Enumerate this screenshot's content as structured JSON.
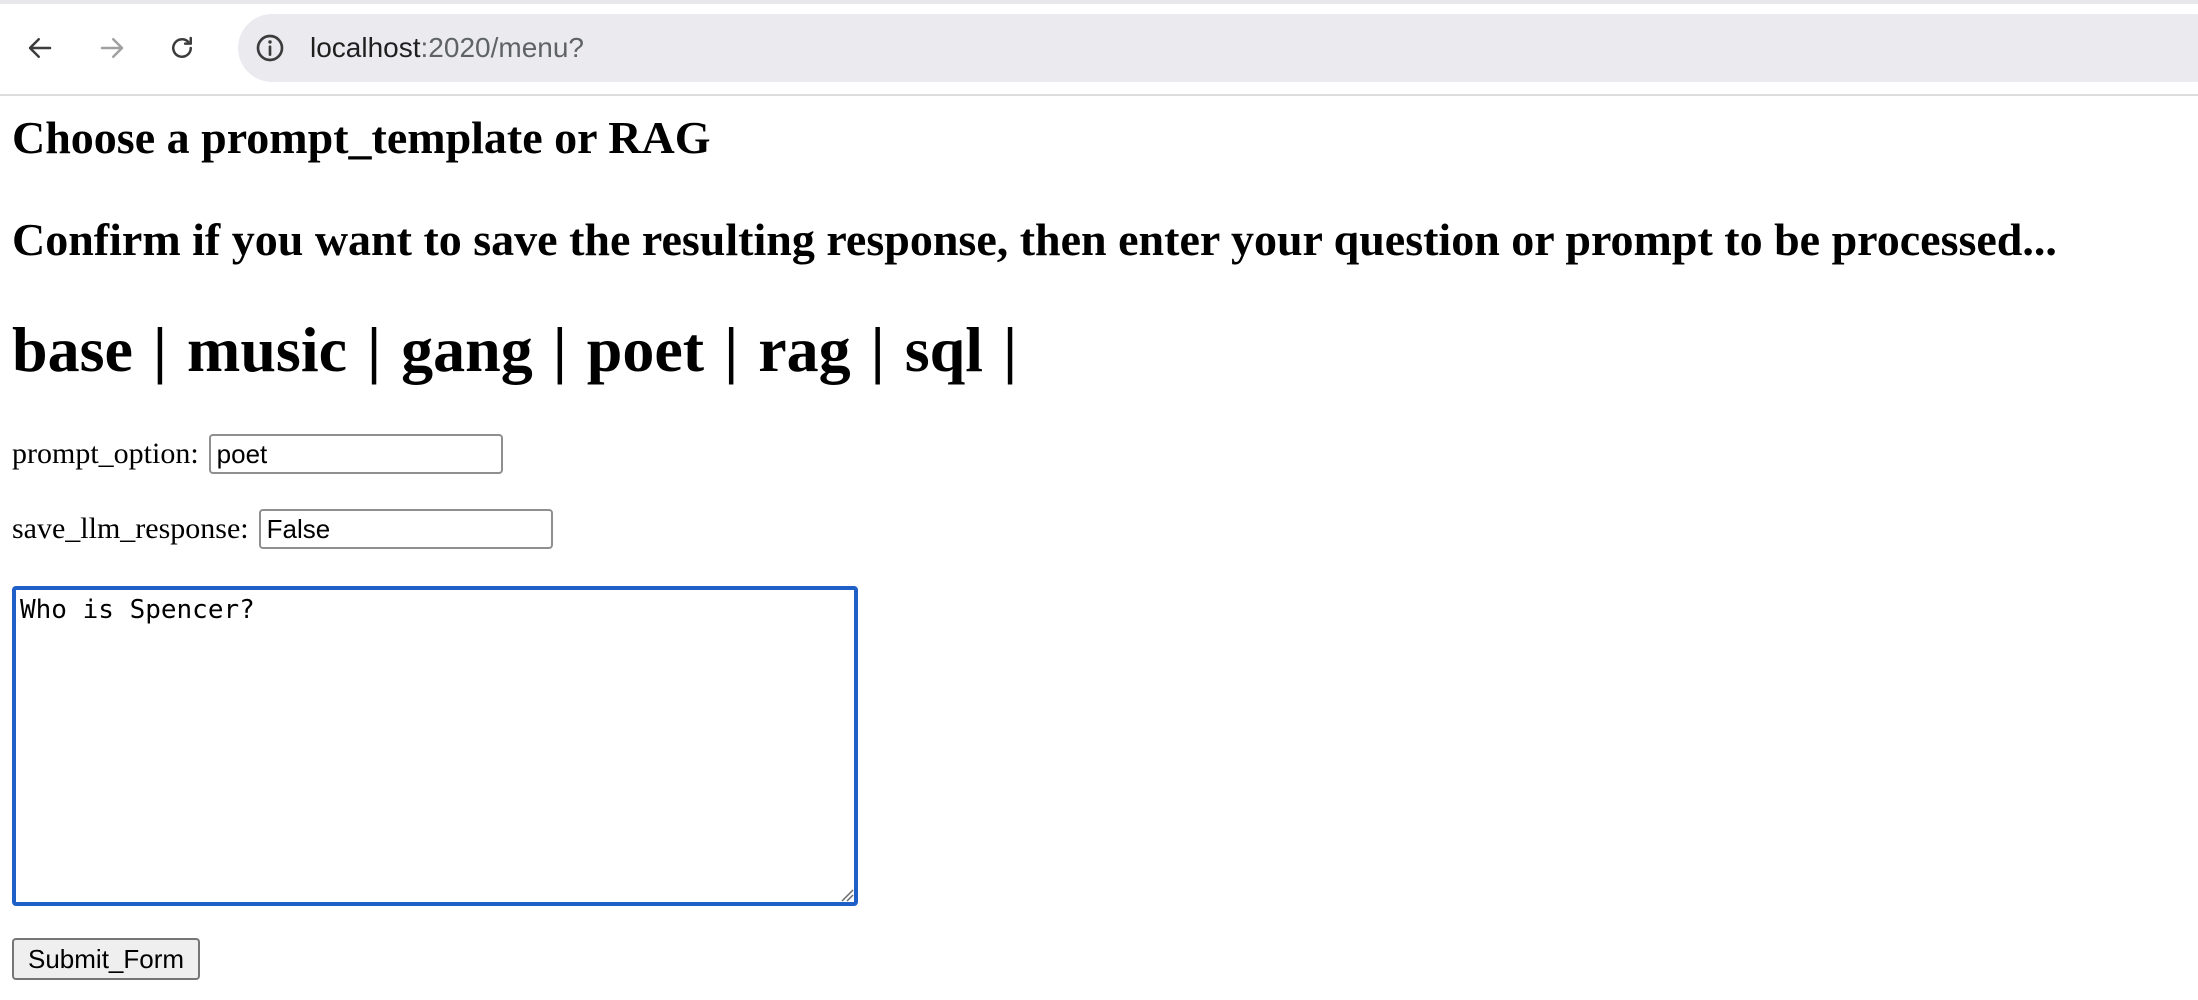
{
  "browser": {
    "url_host": "localhost",
    "url_path": ":2020/menu?",
    "icons": {
      "back": "back-arrow-icon",
      "forward": "forward-arrow-icon",
      "reload": "reload-icon",
      "site_info": "info-icon"
    }
  },
  "page": {
    "heading_choose": "Choose a prompt_template or RAG",
    "heading_confirm": "Confirm if you want to save the resulting response, then enter your question or prompt to be processed...",
    "links": [
      {
        "label": "base"
      },
      {
        "label": "music"
      },
      {
        "label": "gang"
      },
      {
        "label": "poet"
      },
      {
        "label": "rag"
      },
      {
        "label": "sql"
      }
    ],
    "link_separator": "|",
    "prompt_option_label": "prompt_option:",
    "prompt_option_value": "poet",
    "save_llm_response_label": "save_llm_response:",
    "save_llm_response_value": "False",
    "question_text": "Who is Spencer?",
    "submit_label": "Submit_Form"
  },
  "colors": {
    "focus_border": "#1f5fc8",
    "omnibox_bg": "#ebebef",
    "url_path": "#5f6368"
  }
}
